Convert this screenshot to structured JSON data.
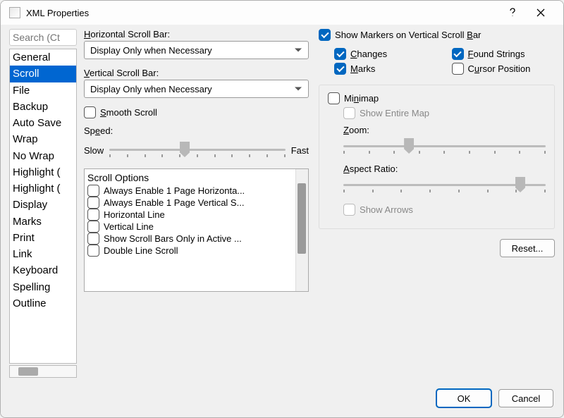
{
  "title": "XML Properties",
  "search_placeholder": "Search (Ct",
  "categories": [
    "General",
    "Scroll",
    "File",
    "Backup",
    "Auto Save",
    "Wrap",
    "No Wrap",
    "Highlight (",
    "Highlight (",
    "Display",
    "Marks",
    "Print",
    "Link",
    "Keyboard",
    "Spelling",
    "Outline"
  ],
  "selected_category_index": 1,
  "left": {
    "hscroll_label": "Horizontal Scroll Bar:",
    "hscroll_value": "Display Only when Necessary",
    "vscroll_label": "Vertical Scroll Bar:",
    "vscroll_value": "Display Only when Necessary",
    "smooth_scroll": {
      "label": "Smooth Scroll",
      "checked": false
    },
    "speed_label": "Speed:",
    "speed_slow": "Slow",
    "speed_fast": "Fast",
    "speed_value": 0.4,
    "options_header": "Scroll Options",
    "options": [
      {
        "label": "Always Enable 1 Page Horizonta...",
        "checked": false
      },
      {
        "label": "Always Enable 1 Page Vertical S...",
        "checked": false
      },
      {
        "label": "Horizontal Line",
        "checked": false
      },
      {
        "label": "Vertical Line",
        "checked": false
      },
      {
        "label": "Show Scroll Bars Only in Active ...",
        "checked": false
      },
      {
        "label": "Double Line Scroll",
        "checked": false
      }
    ]
  },
  "right": {
    "show_markers": {
      "label": "Show Markers on Vertical Scroll Bar",
      "checked": true
    },
    "changes": {
      "label": "Changes",
      "checked": true
    },
    "found_strings": {
      "label": "Found Strings",
      "checked": true
    },
    "marks": {
      "label": "Marks",
      "checked": true
    },
    "cursor_position": {
      "label": "Cursor Position",
      "checked": false
    },
    "minimap": {
      "label": "Minimap",
      "checked": false
    },
    "show_entire_map": {
      "label": "Show Entire Map",
      "checked": false,
      "disabled": true
    },
    "zoom_label": "Zoom:",
    "zoom_value": 0.3,
    "aspect_label": "Aspect Ratio:",
    "aspect_value": 0.85,
    "show_arrows": {
      "label": "Show Arrows",
      "checked": false,
      "disabled": true
    }
  },
  "buttons": {
    "reset": "Reset...",
    "ok": "OK",
    "cancel": "Cancel"
  }
}
